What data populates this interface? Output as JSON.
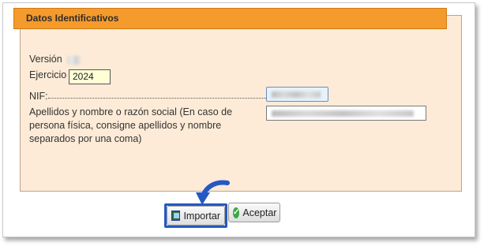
{
  "panel": {
    "title": "Datos Identificativos"
  },
  "form": {
    "version_label": "Versión",
    "ejercicio_label": "Ejercicio",
    "ejercicio_value": "2024",
    "nif_label": "NIF:",
    "apellidos_label": "Apellidos y nombre o razón social (En caso de persona física, consigne apellidos y nombre separados por una coma)"
  },
  "buttons": {
    "importar": "Importar",
    "aceptar": "Aceptar"
  },
  "colors": {
    "header": "#f59a2c",
    "panel_bg": "#fdebd7",
    "highlight": "#2459c4"
  }
}
